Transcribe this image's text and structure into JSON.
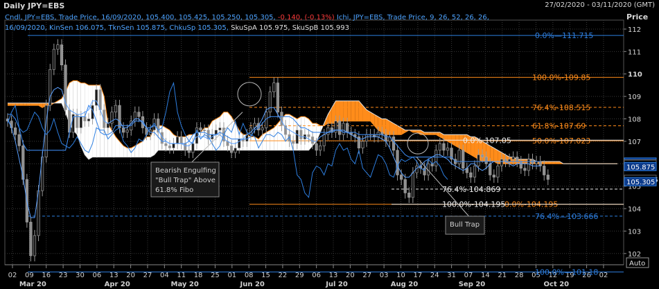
{
  "header": {
    "title": "Daily JPY=EBS",
    "range": "27/02/2020 - 03/11/2020 (GMT)"
  },
  "price_label": "Price",
  "legend": {
    "l1a": "Cndl, JPY=EBS, Trade Price, 16/09/2020, 105.400, 105.425, 105.250, 105.305,",
    "l1b": "-0.140, (-0.13%)",
    "l1c": "Ichi, JPY=EBS, Trade Price,  9, 26, 52, 26, 26,",
    "l2a": "16/09/2020, KinSen 106.075, TknSen 105.875, ChkuSp 105.305,",
    "l2b": "SkuSpA 105.975, SkuSpB 105.993"
  },
  "auto_label": "Auto",
  "colors": {
    "bg": "#000000",
    "grid": "#3a3a3a",
    "blue": "#2e7fe0",
    "orange": "#ff8c1a",
    "white": "#ffffff"
  },
  "chart_data": {
    "type": "candlestick",
    "ylim": [
      101.5,
      112.4
    ],
    "y_ticks": [
      102,
      103,
      104,
      105,
      106,
      107,
      108,
      109,
      110,
      111,
      112
    ],
    "x_ticks": [
      "02",
      "09",
      "16",
      "23",
      "30",
      "06",
      "13",
      "20",
      "27",
      "04",
      "11",
      "18",
      "25",
      "01",
      "08",
      "15",
      "22",
      "29",
      "06",
      "13",
      "20",
      "27",
      "03",
      "10",
      "17",
      "24",
      "31",
      "07",
      "14",
      "21",
      "28",
      "05",
      "12",
      "19",
      "26",
      "02"
    ],
    "months": [
      {
        "label": "Mar 20",
        "tick": 1
      },
      {
        "label": "Apr 20",
        "tick": 6
      },
      {
        "label": "May 20",
        "tick": 10
      },
      {
        "label": "Jun 20",
        "tick": 14
      },
      {
        "label": "Jul 20",
        "tick": 19
      },
      {
        "label": "Aug 20",
        "tick": 23
      },
      {
        "label": "Sep 20",
        "tick": 27
      },
      {
        "label": "Oct 20",
        "tick": 32
      }
    ],
    "fib_blue": [
      {
        "label": "0.0%",
        "value": 111.715,
        "text": "111.715"
      },
      {
        "label": "76.4%",
        "value": 103.666,
        "text": "103.666",
        "dashed": true
      },
      {
        "label": "100.0%",
        "value": 101.18,
        "text": "101.18"
      }
    ],
    "fib_orange": [
      {
        "label": "100.0%",
        "value": 109.85,
        "text": "109.85"
      },
      {
        "label": "76.4%",
        "value": 108.515,
        "text": "108.515",
        "dashed": true
      },
      {
        "label": "61.8%",
        "value": 107.69,
        "text": "107.69",
        "dashed": true
      },
      {
        "label": "50.0%",
        "value": 107.023,
        "text": "107.023"
      },
      {
        "label": "0.0%",
        "value": 104.195,
        "text": "104.195"
      }
    ],
    "fib_white": [
      {
        "label": "0.0%",
        "value": 107.05,
        "text": "107.05"
      },
      {
        "label": "76.4%",
        "value": 104.869,
        "text": "104.869",
        "dashed": true
      },
      {
        "label": "100.0%",
        "value": 104.195,
        "text": "104.195"
      }
    ],
    "price_tags": [
      {
        "value": 106.075,
        "text": "106.075",
        "style": "blue"
      },
      {
        "value": 105.993,
        "text": "105.993",
        "style": "white"
      },
      {
        "value": 105.975,
        "text": "105.975",
        "style": "white"
      },
      {
        "value": 105.875,
        "text": "105.875",
        "style": "blue"
      },
      {
        "value": 105.305,
        "text": "105.305",
        "style": "last"
      },
      {
        "value": 105.2,
        "text": "105.305",
        "style": "blue"
      }
    ],
    "annotations": [
      {
        "text_lines": [
          "Bearish Engulfing",
          "\"Bull Trap\" Above",
          "61.8% Fibo"
        ]
      },
      {
        "text_lines": [
          "Bull Trap"
        ]
      }
    ],
    "close": [
      107.9,
      107.6,
      107.3,
      106.8,
      105.3,
      103.4,
      101.9,
      102.8,
      104.8,
      106.3,
      108.6,
      110.2,
      111.1,
      111.3,
      110.4,
      108.4,
      107.4,
      108.2,
      107.6,
      108.1,
      107.9,
      108.0,
      108.6,
      109.3,
      108.4,
      107.6,
      107.8,
      108.3,
      108.6,
      107.6,
      107.4,
      107.5,
      107.9,
      108.3,
      108.1,
      107.6,
      107.3,
      107.5,
      108.0,
      107.4,
      106.9,
      106.8,
      106.7,
      106.9,
      107.2,
      106.9,
      106.6,
      106.5,
      106.9,
      107.6,
      107.5,
      107.5,
      107.1,
      107.3,
      107.5,
      107.6,
      107.0,
      106.8,
      106.5,
      106.7,
      107.1,
      107.0,
      107.3,
      107.6,
      107.8,
      107.5,
      107.6,
      108.3,
      109.2,
      109.6,
      108.3,
      107.7,
      107.3,
      107.0,
      106.9,
      107.5,
      107.1,
      107.3,
      107.2,
      106.9,
      106.6,
      106.8,
      107.3,
      107.6,
      107.4,
      107.9,
      107.3,
      107.8,
      107.4,
      107.3,
      107.2,
      106.7,
      107.0,
      107.3,
      107.3,
      107.2,
      107.4,
      107.3,
      107.0,
      107.2,
      106.6,
      105.5,
      105.3,
      104.7,
      104.5,
      105.6,
      105.9,
      105.8,
      105.5,
      106.0,
      105.9,
      106.6,
      106.9,
      106.6,
      106.7,
      106.2,
      106.0,
      106.6,
      105.8,
      105.6,
      105.4,
      105.9,
      106.4,
      106.3,
      106.0,
      105.5,
      105.4,
      105.9,
      106.2,
      106.1,
      106.2,
      106.3,
      106.1,
      105.8,
      105.7,
      106.2,
      106.0,
      106.1,
      105.9,
      105.5,
      105.3
    ],
    "kijun": [
      108.2,
      108.2,
      108.0,
      107.6,
      106.9,
      106.6,
      106.6,
      106.6,
      106.6,
      106.6,
      106.6,
      106.6,
      106.6,
      106.6,
      106.6,
      106.6,
      107.4,
      108.1,
      108.1,
      108.1,
      108.1,
      108.6,
      108.4,
      107.9,
      107.4,
      107.3,
      107.3,
      107.4,
      107.7,
      107.7,
      107.7,
      107.7,
      107.7,
      107.9,
      107.9,
      107.9,
      107.6,
      107.4,
      107.4,
      107.2,
      107.0,
      107.0,
      106.9,
      106.9,
      106.9,
      106.9,
      106.9,
      107.0,
      107.3,
      107.4,
      107.4,
      107.4,
      107.3,
      107.3,
      107.3,
      107.4,
      107.3,
      107.2,
      107.1,
      107.1,
      107.1,
      107.1,
      107.1,
      107.2,
      107.5,
      107.6,
      107.8,
      108.0,
      108.1,
      108.1,
      108.1,
      108.1,
      108.1,
      108.1,
      108.0,
      107.8,
      107.6,
      107.6,
      107.5,
      107.4,
      107.4,
      107.4,
      107.4,
      107.4,
      107.4,
      107.5,
      107.5,
      107.4,
      107.4,
      107.4,
      107.4,
      107.3,
      107.3,
      107.3,
      107.3,
      107.3,
      107.3,
      107.3,
      107.2,
      107.2,
      107.0,
      106.8,
      106.6,
      106.4,
      106.3,
      106.3,
      106.3,
      106.3,
      106.3,
      106.3,
      106.3,
      106.3,
      106.3,
      106.3,
      106.3,
      106.3,
      106.1,
      106.1,
      106.1,
      106.1,
      106.1,
      106.1,
      106.1,
      106.1,
      106.1,
      106.1,
      106.1,
      106.1,
      106.1,
      106.1,
      106.1,
      106.1,
      106.1,
      106.1,
      106.1,
      106.1,
      106.1,
      106.1,
      106.1
    ],
    "tenkan": [
      108.0,
      107.6,
      107.0,
      106.2,
      105.4,
      104.3,
      103.6,
      103.6,
      104.8,
      106.4,
      107.9,
      109.0,
      109.3,
      109.4,
      109.3,
      108.7,
      108.4,
      108.3,
      108.2,
      108.2,
      108.3,
      108.4,
      108.8,
      108.8,
      108.4,
      107.9,
      107.8,
      107.9,
      108.0,
      107.9,
      107.6,
      107.6,
      107.8,
      108.0,
      108.0,
      107.8,
      107.6,
      107.6,
      107.7,
      107.5,
      107.2,
      107.0,
      106.9,
      106.9,
      106.9,
      106.9,
      106.8,
      106.8,
      107.0,
      107.2,
      107.2,
      107.2,
      107.1,
      107.2,
      107.3,
      107.3,
      107.1,
      107.0,
      106.9,
      106.9,
      107.0,
      107.1,
      107.3,
      107.4,
      107.6,
      107.7,
      108.0,
      108.4,
      108.5,
      108.5,
      108.2,
      107.9,
      107.6,
      107.5,
      107.4,
      107.3,
      107.2,
      107.2,
      107.1,
      107.0,
      107.0,
      107.2,
      107.3,
      107.4,
      107.5,
      107.5,
      107.5,
      107.5,
      107.4,
      107.3,
      107.2,
      107.1,
      107.1,
      107.2,
      107.2,
      107.2,
      107.2,
      107.1,
      107.0,
      106.7,
      106.3,
      105.9,
      105.6,
      105.4,
      105.4,
      105.6,
      105.8,
      105.9,
      106.1,
      106.2,
      106.3,
      106.4,
      106.4,
      106.3,
      106.2,
      106.0,
      105.9,
      105.8,
      105.7,
      105.8,
      106.0,
      106.0,
      105.8,
      105.7,
      105.8,
      106.0,
      106.1,
      106.1,
      106.1,
      106.1,
      106.0,
      105.9,
      106.0,
      106.0,
      106.0,
      106.0,
      105.9,
      105.9,
      105.9
    ],
    "span_a": [
      108.6,
      108.6,
      108.6,
      108.6,
      108.6,
      108.6,
      108.6,
      108.6,
      108.6,
      108.5,
      108.6,
      108.6,
      108.7,
      108.8,
      108.9,
      109.2,
      109.6,
      109.7,
      109.7,
      109.6,
      109.6,
      109.5,
      109.5,
      109.5,
      109.5,
      109.0,
      107.8,
      107.5,
      107.2,
      107.0,
      106.8,
      106.7,
      106.7,
      106.8,
      106.9,
      107.0,
      107.2,
      107.2,
      107.6,
      107.7,
      107.7,
      107.6,
      107.5,
      107.3,
      107.2,
      107.2,
      107.2,
      107.3,
      107.3,
      107.4,
      107.4,
      107.6,
      107.6,
      107.9,
      108.0,
      108.1,
      108.3,
      108.3,
      108.1,
      107.8,
      107.5,
      107.3,
      107.3,
      107.2,
      107.2,
      107.1,
      107.3,
      107.4,
      107.5,
      107.6,
      107.8,
      108.0,
      108.2,
      108.2,
      108.1,
      108.0,
      108.1,
      108.1,
      108.0,
      107.8,
      107.8,
      107.7,
      107.7,
      107.8,
      107.8,
      107.8,
      107.9,
      107.9,
      107.9,
      107.9,
      107.9,
      107.9,
      107.9,
      107.9,
      107.9,
      107.7,
      107.5,
      107.4,
      107.3,
      107.3,
      107.3,
      107.3,
      107.3,
      107.4,
      107.5,
      107.4,
      107.4,
      107.3,
      107.3,
      107.3,
      107.3,
      107.3,
      107.2,
      107.1,
      107.0,
      106.9,
      106.8,
      106.7,
      106.6,
      106.5,
      106.4,
      106.3,
      106.2,
      106.1,
      106.1,
      106.1,
      106.1,
      106.0,
      106.0,
      106.0,
      106.0,
      106.0,
      106.0,
      106.0,
      106.0,
      106.0,
      106.0,
      106.0,
      106.0,
      106.0,
      106.0,
      106.0,
      106.0,
      106.0,
      106.0,
      106.0,
      106.0,
      106.0,
      106.0,
      106.0,
      106.0,
      106.0,
      106.0,
      106.0,
      106.0,
      106.0,
      106.0,
      106.0,
      106.0
    ],
    "span_b": [
      108.7,
      108.7,
      108.7,
      108.7,
      108.7,
      108.7,
      108.7,
      108.7,
      108.7,
      108.7,
      108.7,
      108.7,
      108.7,
      108.7,
      108.7,
      108.3,
      107.8,
      107.5,
      107.3,
      106.8,
      106.4,
      106.2,
      106.3,
      106.3,
      106.3,
      106.3,
      106.3,
      106.3,
      106.3,
      106.3,
      106.3,
      106.3,
      106.3,
      106.3,
      106.3,
      106.3,
      106.3,
      106.3,
      106.4,
      106.6,
      106.6,
      106.6,
      106.6,
      106.6,
      106.6,
      106.6,
      106.6,
      106.6,
      106.6,
      106.6,
      106.6,
      106.6,
      106.6,
      106.6,
      106.6,
      106.6,
      106.6,
      106.6,
      106.6,
      106.6,
      106.6,
      106.6,
      106.6,
      106.6,
      106.6,
      106.6,
      106.6,
      106.6,
      106.6,
      106.6,
      106.6,
      106.6,
      106.6,
      106.6,
      106.6,
      106.6,
      106.6,
      106.6,
      106.6,
      106.8,
      107.0,
      107.4,
      107.8,
      108.2,
      108.5,
      108.8,
      108.8,
      108.8,
      108.8,
      108.8,
      108.8,
      108.8,
      108.6,
      108.4,
      108.3,
      108.2,
      108.1,
      108.0,
      108.0,
      107.9,
      107.8,
      107.7,
      107.6,
      107.5,
      107.5,
      107.5,
      107.5,
      107.5,
      107.4,
      107.4,
      107.4,
      107.4,
      107.4,
      107.3,
      107.3,
      107.3,
      107.3,
      107.3,
      107.3,
      107.3,
      107.2,
      107.2,
      107.1,
      107.0,
      106.9,
      106.8,
      106.7,
      106.6,
      106.5,
      106.4,
      106.3,
      106.3,
      106.2,
      106.2,
      106.2,
      106.2,
      106.2,
      106.1,
      106.1,
      106.1,
      106.1,
      106.1,
      106.1,
      106.1,
      106.0,
      106.0,
      106.0,
      106.0,
      106.0,
      106.0,
      106.0,
      106.0,
      106.0,
      106.0,
      106.0,
      106.0,
      106.0,
      106.0,
      106.0
    ]
  }
}
